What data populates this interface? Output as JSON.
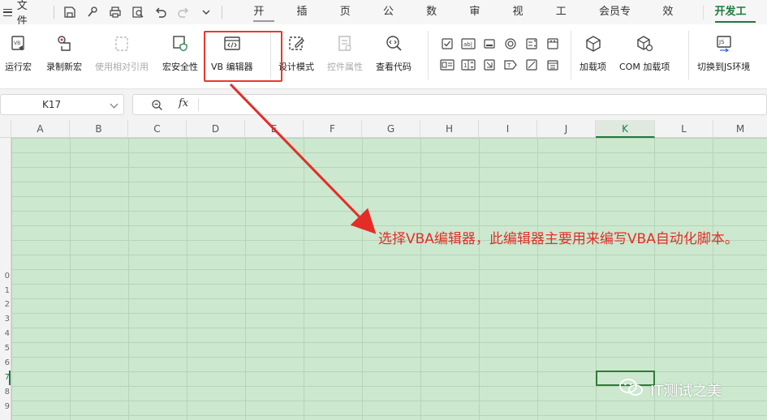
{
  "menubar": {
    "file_label": "文件",
    "tabs": [
      "开始",
      "插入",
      "页面",
      "公式",
      "数据",
      "审阅",
      "视图",
      "工具",
      "会员专享",
      "效率",
      "开发工具"
    ],
    "active_tab": "开发工具"
  },
  "ribbon": {
    "buttons": {
      "run_macro": "运行宏",
      "record_macro": "录制新宏",
      "relative_ref": "使用相对引用",
      "macro_security": "宏安全性",
      "vb_editor": "VB 编辑器",
      "design_mode": "设计模式",
      "control_props": "控件属性",
      "view_code": "查看代码",
      "addins": "加载项",
      "com_addins": "COM 加载项",
      "switch_js": "切换到JS环境"
    }
  },
  "formula_bar": {
    "name_box": "K17",
    "fx_label": "fx"
  },
  "sheet": {
    "columns": [
      "A",
      "B",
      "C",
      "D",
      "E",
      "F",
      "G",
      "H",
      "I",
      "J",
      "K",
      "L",
      "M"
    ],
    "active_column": "K",
    "rows": [
      "",
      "",
      "",
      "",
      "",
      "",
      "",
      "",
      "",
      "0",
      "1",
      "2",
      "3",
      "4",
      "5",
      "6",
      "7",
      "8",
      "9"
    ],
    "active_row": "7"
  },
  "annotation": {
    "text": "选择VBA编辑器，此编辑器主要用来编写VBA自动化脚本。",
    "color": "#e52d27"
  },
  "watermark": {
    "text": "IT测试之美"
  },
  "colors": {
    "accent": "#1f7a3a",
    "cell_bg": "#cce8cf",
    "highlight": "#e53a2d"
  }
}
